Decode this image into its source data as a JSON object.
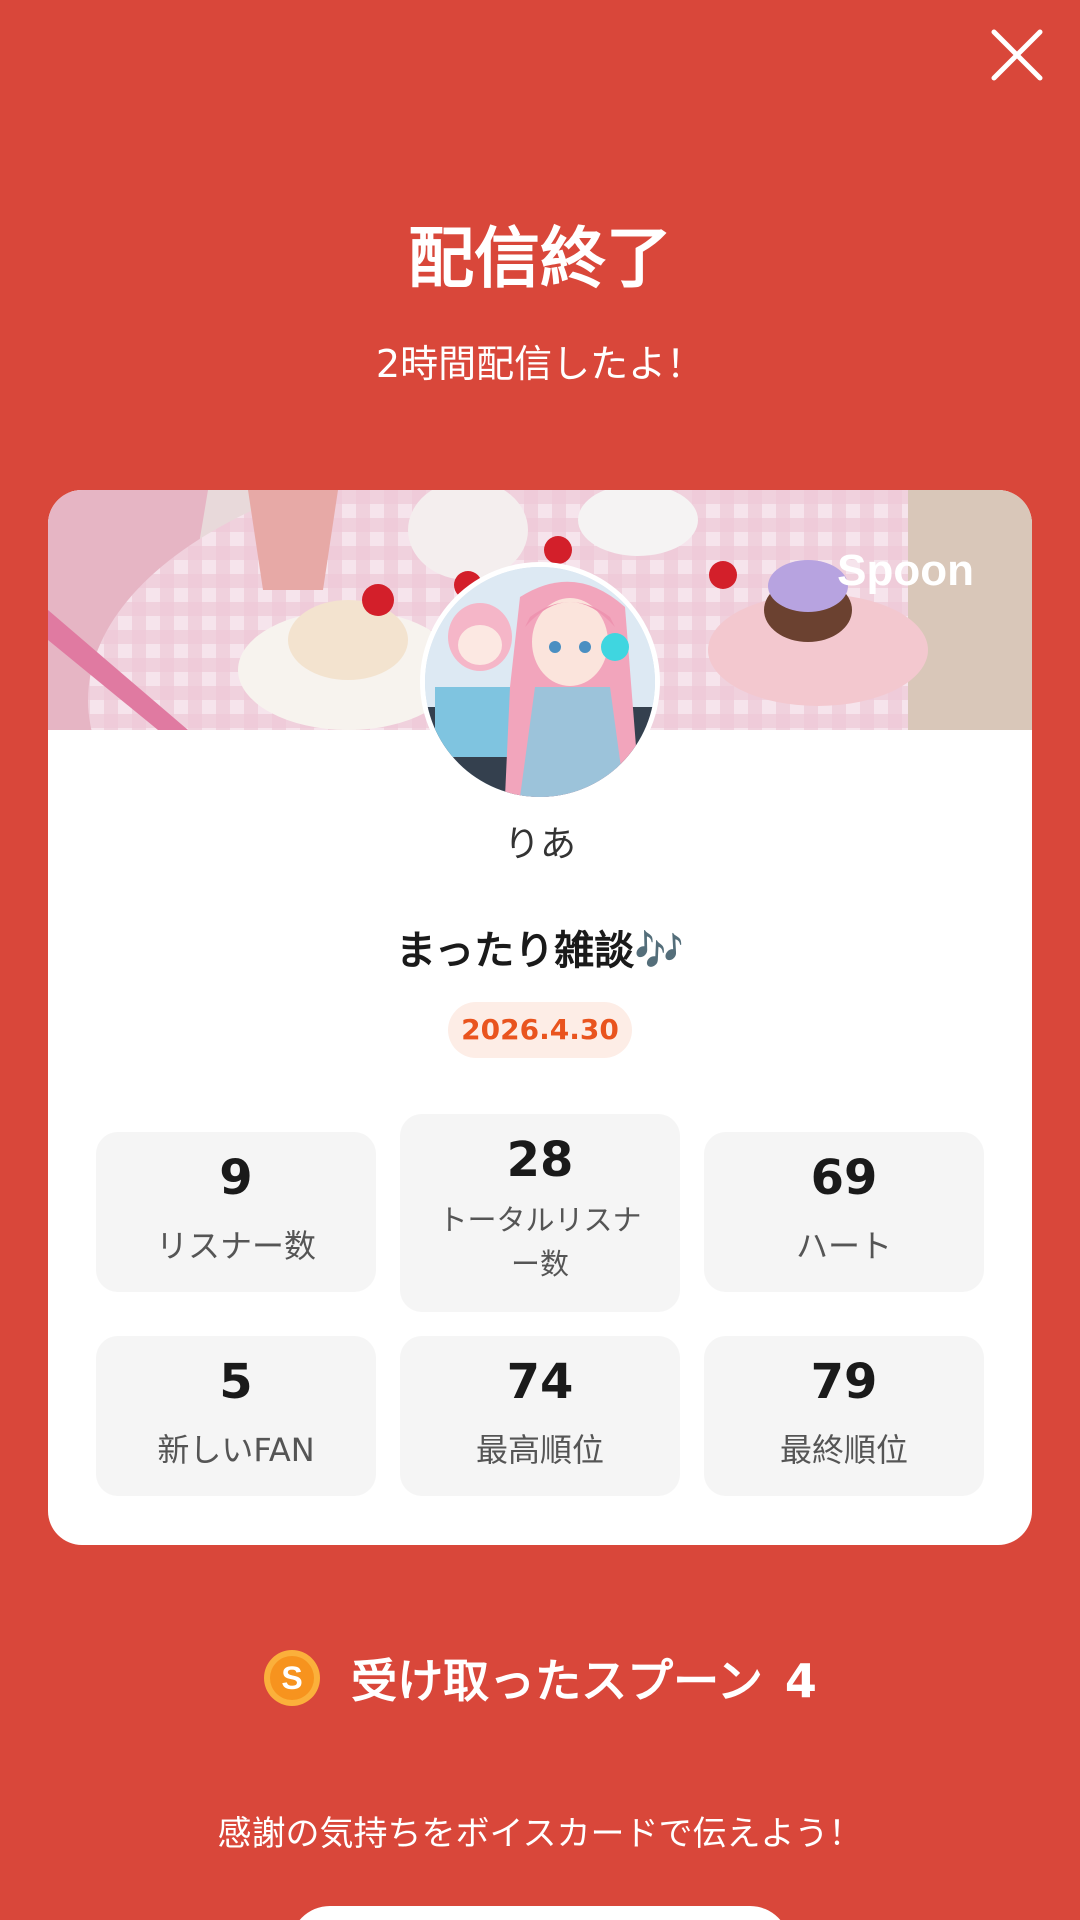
{
  "header": {
    "close_icon": "close-icon",
    "title": "配信終了",
    "subtitle": "2時間配信したよ！"
  },
  "card": {
    "logo": "Spoon",
    "username": "りあ",
    "live_title": "まったり雑談",
    "live_title_emoji": "🎶",
    "date": "2026.4.30",
    "stats": [
      {
        "value": "9",
        "label": "リスナー数"
      },
      {
        "value": "28",
        "label": "トータルリスナー数"
      },
      {
        "value": "69",
        "label": "ハート"
      },
      {
        "value": "5",
        "label": "新しいFAN"
      },
      {
        "value": "74",
        "label": "最高順位"
      },
      {
        "value": "79",
        "label": "最終順位"
      }
    ]
  },
  "spoons": {
    "icon": "spoon-coin-icon",
    "label": "受け取ったスプーン",
    "count": "4"
  },
  "footer": {
    "thanks_text": "感謝の気持ちをボイスカードで伝えよう！"
  },
  "colors": {
    "background": "#D9473A",
    "date_text": "#E9541E",
    "date_badge_bg": "#FDEDE6",
    "stat_bg": "#F5F5F5"
  }
}
